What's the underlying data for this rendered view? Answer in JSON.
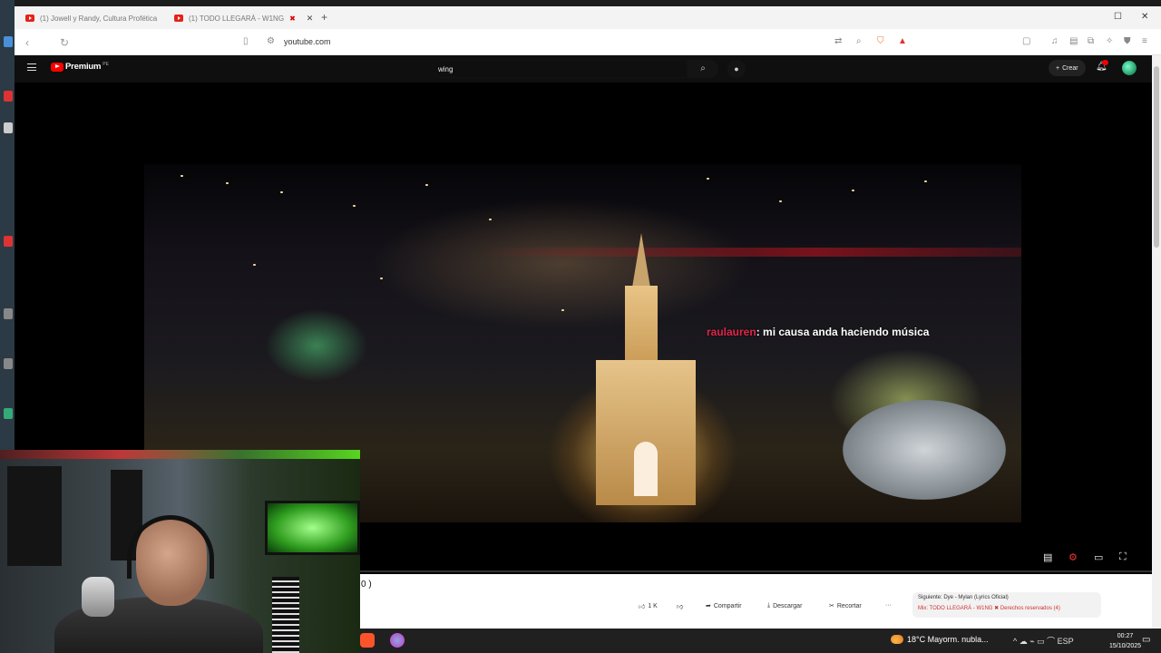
{
  "browser": {
    "tabs": [
      {
        "label": "(1) Jowell y Randy, Cultura Profética",
        "active": false
      },
      {
        "label": "(1) TODO LLEGARÁ - W1NG",
        "active": true,
        "badge": "✖"
      }
    ],
    "new_tab": "+",
    "url": "youtube.com"
  },
  "youtube": {
    "logo_word": "Premium",
    "logo_cc": "PE",
    "search_value": "wing",
    "create_label": "Crear",
    "chat_overlay": {
      "user": "raulauren",
      "message": ": mi causa anda haciendo música"
    },
    "title_fragment": "0 )",
    "actions": [
      {
        "icon": "like-icon",
        "label": "1 K"
      },
      {
        "icon": "dislike-icon",
        "label": ""
      },
      {
        "icon": "share-icon",
        "label": "Compartir"
      },
      {
        "icon": "download-icon",
        "label": "Descargar"
      },
      {
        "icon": "clip-icon",
        "label": "Recortar"
      },
      {
        "icon": "more-icon",
        "label": "···"
      }
    ],
    "next_up": {
      "line1": "Siguiente: Dye - Mylan (Lyrics Oficial)",
      "line2": "Mix: TODO LLEGARÁ - W1NG ✖ Derechos reservados (4)"
    }
  },
  "taskbar": {
    "weather": "18°C  Mayorm. nubla...",
    "tray": "^  ☁  ⌁  ▭  ⌒  ESP",
    "time": "00:27",
    "date": "15/10/2025"
  },
  "colors": {
    "yt_red": "#ff0000",
    "chat_user": "#e0264a",
    "player_bg": "#000000"
  }
}
